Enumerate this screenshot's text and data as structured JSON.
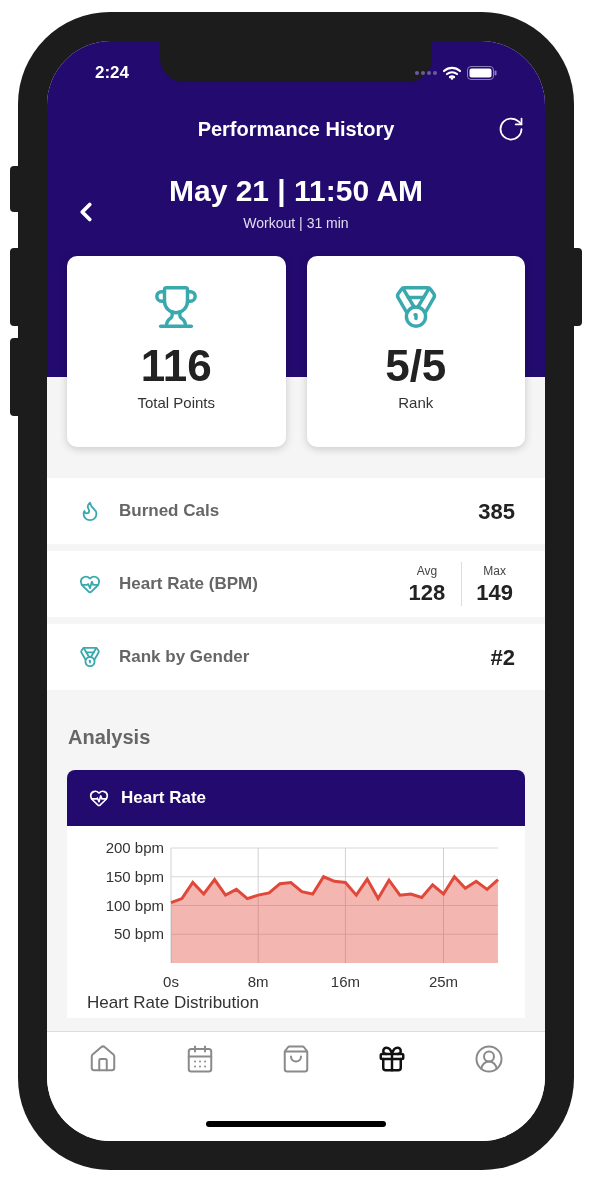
{
  "status_bar": {
    "time": "2:24"
  },
  "header": {
    "title": "Performance History",
    "date": "May 21 | 11:50 AM",
    "subtitle": "Workout | 31 min"
  },
  "summary_cards": [
    {
      "value": "116",
      "label": "Total Points"
    },
    {
      "value": "5/5",
      "label": "Rank"
    }
  ],
  "stats": [
    {
      "kind": "single",
      "label": "Burned Cals",
      "value": "385"
    },
    {
      "kind": "pair",
      "label": "Heart Rate (BPM)",
      "values": [
        {
          "label": "Avg",
          "value": "128"
        },
        {
          "label": "Max",
          "value": "149"
        }
      ]
    },
    {
      "kind": "single",
      "label": "Rank by Gender",
      "value": "#2"
    }
  ],
  "analysis": {
    "title": "Analysis",
    "card": {
      "title": "Heart Rate",
      "chart_data": {
        "type": "area",
        "x": [
          0,
          1,
          2,
          3,
          4,
          5,
          6,
          7,
          8,
          9,
          10,
          11,
          12,
          13,
          14,
          15,
          16,
          17,
          18,
          19,
          20,
          21,
          22,
          23,
          24,
          25,
          26,
          27,
          28,
          29,
          30
        ],
        "grid": true,
        "series": [
          {
            "color": "#e0483a",
            "values": [
              105,
              112,
              140,
              120,
              145,
              118,
              128,
              112,
              118,
              122,
              138,
              140,
              124,
              120,
              150,
              142,
              140,
              118,
              146,
              112,
              144,
              118,
              120,
              114,
              136,
              120,
              150,
              130,
              142,
              128,
              145
            ]
          }
        ],
        "xlim": [
          0,
          30
        ],
        "ylim": [
          0,
          200
        ],
        "xticks": [
          {
            "value": 0,
            "label": "0s"
          },
          {
            "value": 8,
            "label": "8m"
          },
          {
            "value": 16,
            "label": "16m"
          },
          {
            "value": 25,
            "label": "25m"
          }
        ],
        "yticks": [
          {
            "value": 50,
            "label": "50 bpm"
          },
          {
            "value": 100,
            "label": "100 bpm"
          },
          {
            "value": 150,
            "label": "150 bpm"
          },
          {
            "value": 200,
            "label": "200 bpm"
          }
        ]
      }
    },
    "next_title": "Heart Rate Distribution"
  },
  "tab_bar": [
    {
      "selected": false
    },
    {
      "selected": false
    },
    {
      "selected": false
    },
    {
      "selected": true
    },
    {
      "selected": false
    }
  ]
}
